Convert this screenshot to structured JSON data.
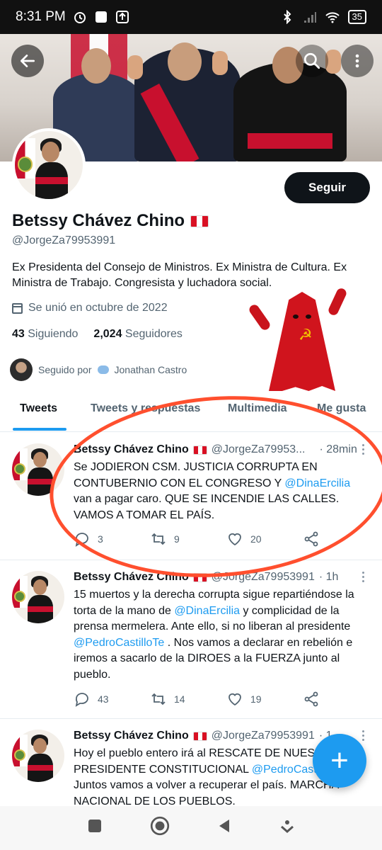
{
  "status_bar": {
    "time": "8:31 PM",
    "battery": "35"
  },
  "profile": {
    "name": "Betssy Chávez Chino",
    "handle": "@JorgeZa79953991",
    "bio": "Ex Presidenta del Consejo de Ministros. Ex Ministra de Cultura. Ex Ministra de Trabajo. Congresista y luchadora social.",
    "joined": "Se unió en octubre de 2022",
    "following_count": "43",
    "following_label": "Siguiendo",
    "followers_count": "2,024",
    "followers_label": "Seguidores",
    "followed_by_prefix": "Seguido por",
    "followed_by_name": "Jonathan Castro",
    "follow_button": "Seguir"
  },
  "tabs": [
    "Tweets",
    "Tweets y respuestas",
    "Multimedia",
    "Me gusta"
  ],
  "tweets": [
    {
      "name": "Betssy Chávez Chino",
      "handle": "@JorgeZa79953...",
      "time": "· 28min",
      "text_parts": [
        "Se JODIERON CSM. JUSTICIA CORRUPTA EN CONTUBERNIO CON EL CONGRESO Y ",
        "@DinaErcilia",
        " van a pagar caro. QUE SE INCENDIE LAS CALLES. VAMOS A TOMAR EL PAÍS."
      ],
      "replies": "3",
      "retweets": "9",
      "likes": "20"
    },
    {
      "name": "Betssy Chávez Chino",
      "handle": "@JorgeZa79953991",
      "time": "· 1h",
      "text_parts": [
        "15 muertos y la derecha corrupta sigue repartiéndose la torta de la mano de ",
        "@DinaErcilia",
        " y complicidad de la prensa mermelera. Ante ello, si no liberan al presidente ",
        "@PedroCastilloTe",
        " . Nos vamos a declarar en rebelión e iremos a sacarlo de la DIROES  a la FUERZA junto al pueblo."
      ],
      "replies": "43",
      "retweets": "14",
      "likes": "19"
    },
    {
      "name": "Betssy Chávez Chino",
      "handle": "@JorgeZa79953991",
      "time": "· 1",
      "text_parts": [
        "Hoy el pueblo entero irá al RESCATE DE NUES",
        "",
        "PRESIDENTE CONSTITUCIONAL ",
        "@PedroCast",
        "Juntos vamos a volver a recuperar el país. MARCHA NACIONAL DE LOS PUEBLOS."
      ]
    }
  ],
  "fab_label": "+",
  "colors": {
    "accent": "#1d9bf0",
    "annotation": "#ff4f2e",
    "text_secondary": "#536471"
  }
}
